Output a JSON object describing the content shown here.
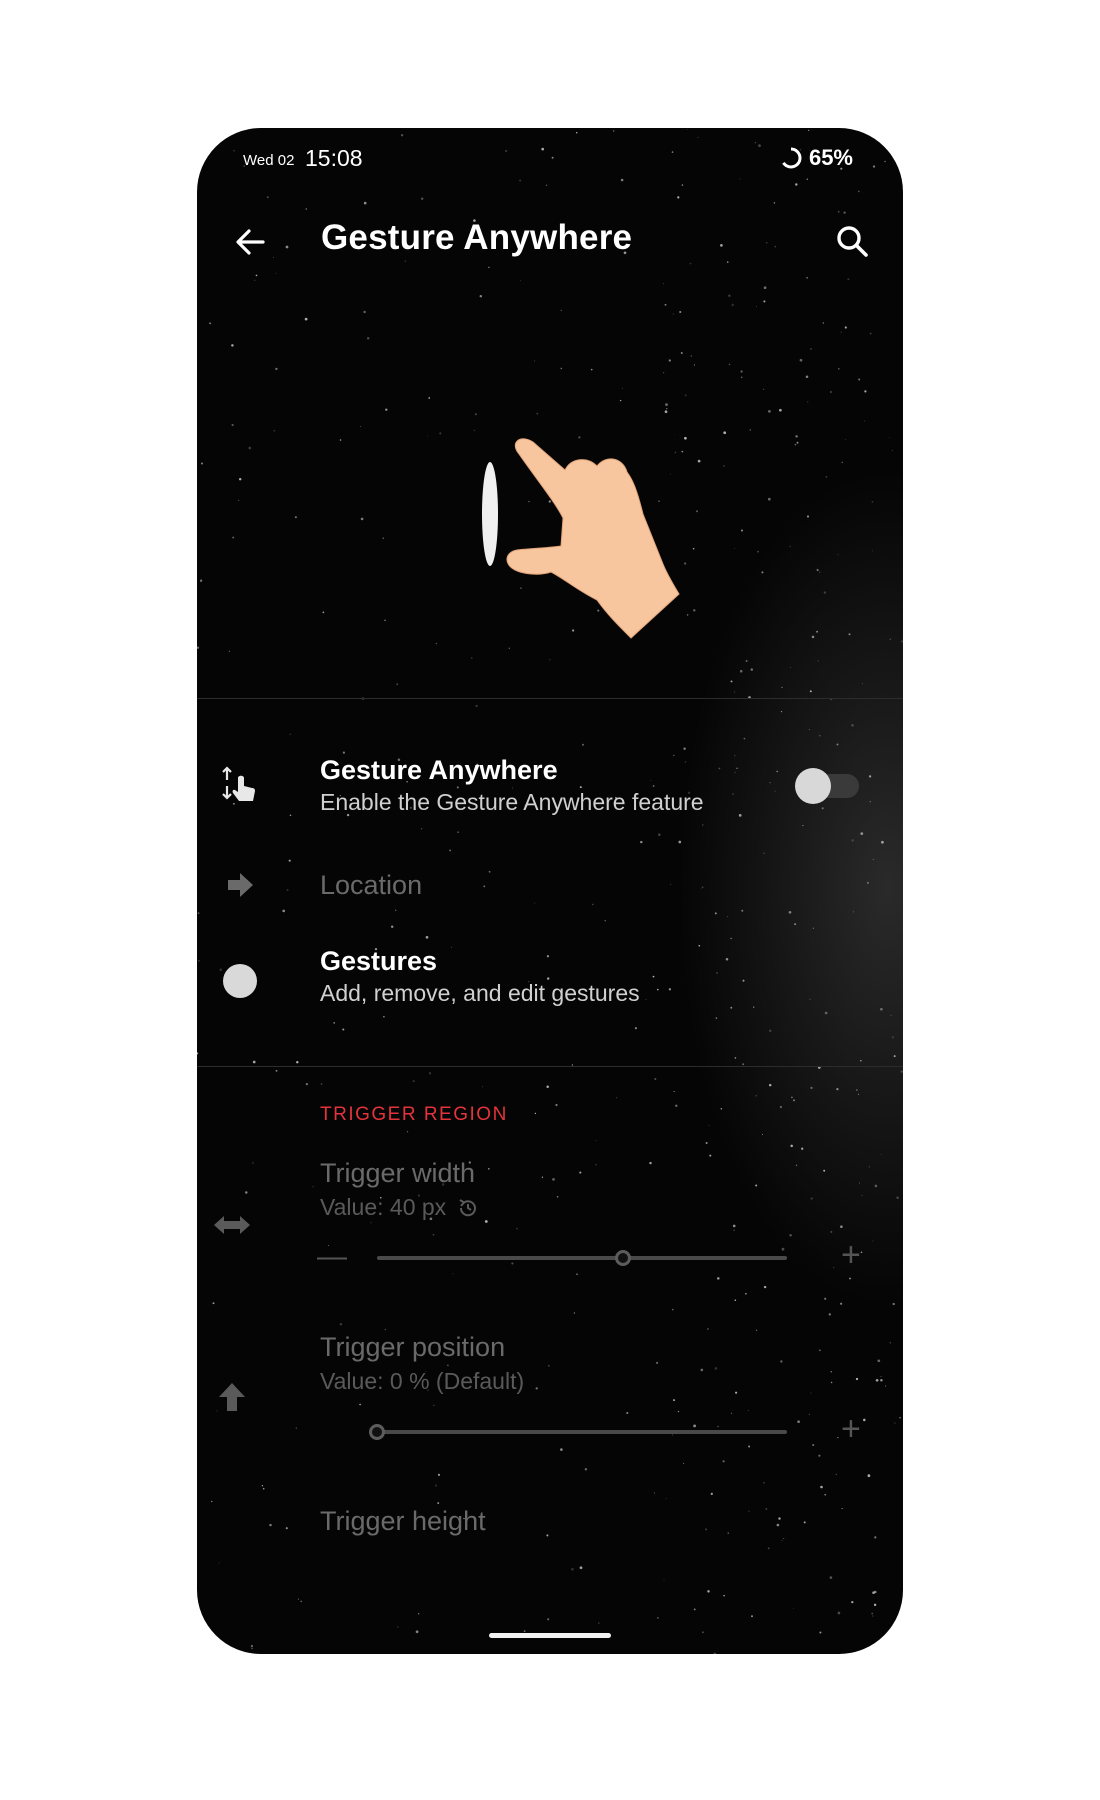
{
  "status_bar": {
    "day": "Wed 02",
    "time": "15:08",
    "battery": "65%"
  },
  "app_bar": {
    "title": "Gesture Anywhere",
    "back_icon": "arrow-back-icon",
    "search_icon": "search-icon"
  },
  "settings": [
    {
      "title": "Gesture Anywhere",
      "subtitle": "Enable the Gesture Anywhere feature",
      "icon": "gesture-swipe-icon",
      "toggle_on": false
    },
    {
      "title": "Location",
      "icon": "arrow-right-icon",
      "disabled": true
    },
    {
      "title": "Gestures",
      "subtitle": "Add, remove, and edit gestures",
      "icon": "circle-icon"
    }
  ],
  "trigger_region": {
    "header": "TRIGGER REGION",
    "width": {
      "title": "Trigger width",
      "value": "Value: 40 px",
      "slider_fraction": 0.6
    },
    "position": {
      "title": "Trigger position",
      "value": "Value: 0 % (Default)",
      "slider_fraction": 0.0
    },
    "height": {
      "title": "Trigger height"
    }
  },
  "colors": {
    "background": "#050505",
    "accent": "#e5333a",
    "text": "#ffffff"
  }
}
